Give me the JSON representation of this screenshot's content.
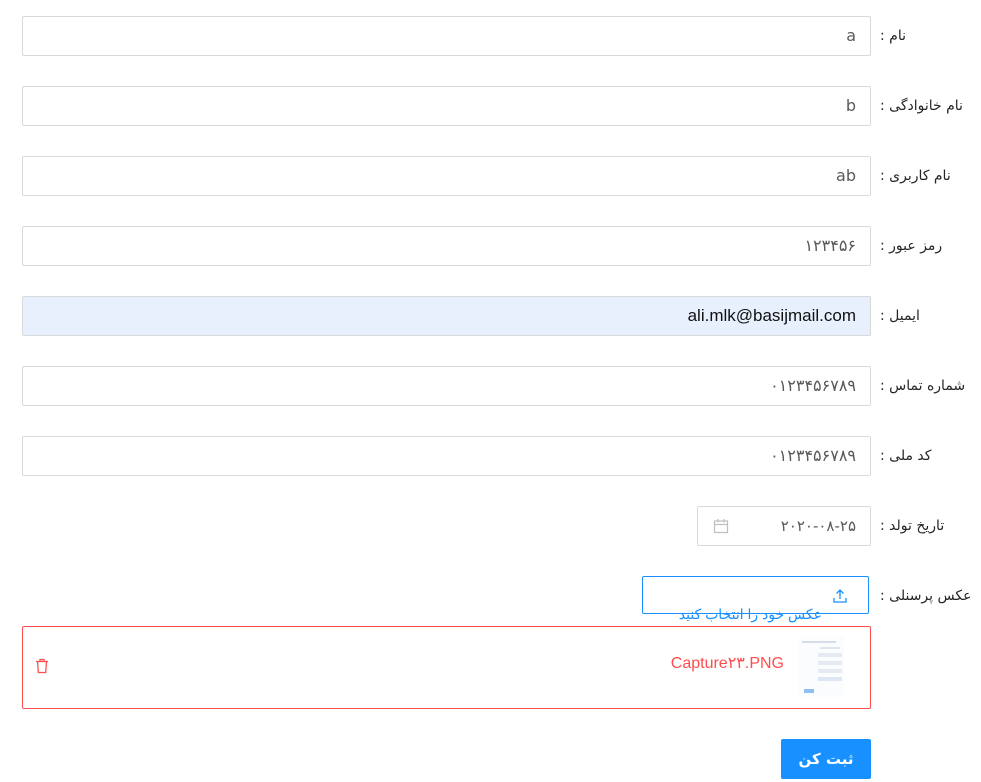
{
  "form": {
    "fields": [
      {
        "label": "نام :",
        "value": "a"
      },
      {
        "label": "نام خانوادگی :",
        "value": "b"
      },
      {
        "label": "نام کاربری :",
        "value": "ab"
      },
      {
        "label": "رمز عبور :",
        "value": "۱۲۳۴۵۶"
      },
      {
        "label": "ایمیل :",
        "value": "ali.mlk@basijmail.com"
      },
      {
        "label": "شماره تماس :",
        "value": "۰۱۲۳۴۵۶۷۸۹"
      },
      {
        "label": "کد ملی :",
        "value": "۰۱۲۳۴۵۶۷۸۹"
      }
    ],
    "birthdate": {
      "label": "تاریخ تولد :",
      "value": "۲۰۲۰-۰۸-۲۵",
      "icon": "calendar-icon"
    },
    "photo": {
      "label": "عکس پرسنلی :",
      "button_label": "عکس خود را انتخاب کنید",
      "button_icon": "upload-icon",
      "file": {
        "name": "Capture۲۳.PNG",
        "status_color": "#ff4d4f",
        "delete_icon": "trash-icon"
      }
    },
    "submit_label": "ثبت کن"
  },
  "colors": {
    "primary": "#1890ff",
    "error": "#ff4d4f",
    "autofill": "#e8f0fe"
  }
}
